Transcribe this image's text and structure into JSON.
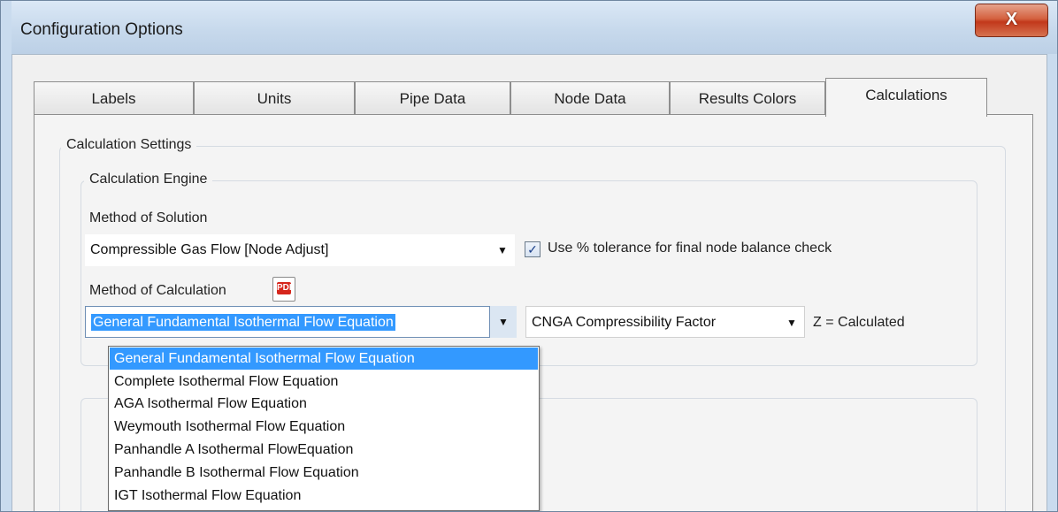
{
  "window": {
    "title": "Configuration Options",
    "close_label": "X"
  },
  "tabs": [
    {
      "label": "Labels"
    },
    {
      "label": "Units"
    },
    {
      "label": "Pipe Data"
    },
    {
      "label": "Node Data"
    },
    {
      "label": "Results Colors"
    },
    {
      "label": "Calculations",
      "active": true
    }
  ],
  "settings": {
    "group_label": "Calculation Settings",
    "engine": {
      "group_label": "Calculation Engine",
      "method_solution_label": "Method of Solution",
      "method_solution_value": "Compressible Gas Flow [Node Adjust]",
      "tolerance_checked": true,
      "tolerance_label": "Use % tolerance for final node balance check",
      "method_calc_label": "Method of Calculation",
      "method_calc_value": "General Fundamental Isothermal Flow Equation",
      "compressibility_value": "CNGA Compressibility Factor",
      "z_label": "Z = Calculated"
    }
  },
  "dropdown": {
    "options": [
      "General Fundamental Isothermal Flow Equation",
      "Complete Isothermal Flow Equation",
      "AGA Isothermal Flow Equation",
      "Weymouth Isothermal Flow Equation",
      "Panhandle A Isothermal FlowEquation",
      "Panhandle B Isothermal Flow Equation",
      "IGT Isothermal Flow Equation"
    ],
    "selected_index": 0
  },
  "colors": {
    "accent": "#3399ff",
    "close": "#c2381b"
  },
  "icons": {
    "pdf": "pdf-icon",
    "check": "checkmark-icon",
    "chevron": "chevron-down-icon"
  }
}
